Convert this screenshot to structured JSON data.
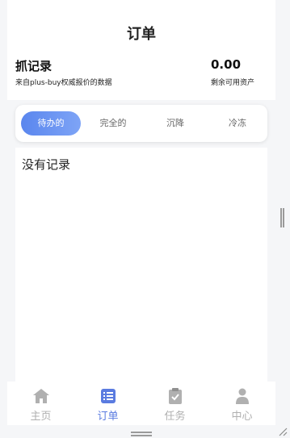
{
  "header": {
    "title": "订单",
    "record_title": "抓记录",
    "record_subtitle": "来自plus-buy权威报价的数据",
    "amount": "0.00",
    "amount_label": "剩余可用资产"
  },
  "tabs": [
    {
      "label": "待办的",
      "active": true
    },
    {
      "label": "完全的",
      "active": false
    },
    {
      "label": "沉降",
      "active": false
    },
    {
      "label": "冷冻",
      "active": false
    }
  ],
  "content": {
    "empty_text": "没有记录"
  },
  "tabbar": {
    "items": [
      {
        "label": "主页",
        "icon": "home-icon",
        "active": false
      },
      {
        "label": "订单",
        "icon": "list-icon",
        "active": true
      },
      {
        "label": "任务",
        "icon": "clipboard-check-icon",
        "active": false
      },
      {
        "label": "中心",
        "icon": "user-icon",
        "active": false
      }
    ]
  },
  "colors": {
    "accent": "#5a86ee",
    "accent_light": "#7ea4f6",
    "inactive": "#b0b0b0",
    "background": "#f5f6f8"
  }
}
